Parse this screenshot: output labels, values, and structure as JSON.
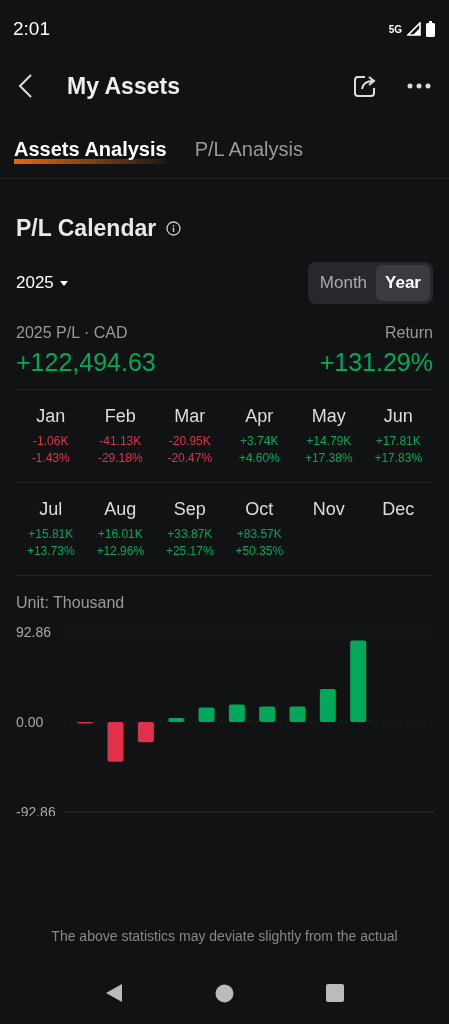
{
  "status_bar": {
    "time": "2:01",
    "network": "5G"
  },
  "header": {
    "title": "My Assets"
  },
  "tabs": [
    {
      "label": "Assets Analysis",
      "selected": true
    },
    {
      "label": "P/L Analysis",
      "selected": false
    }
  ],
  "section": {
    "title": "P/L Calendar"
  },
  "year_picker": {
    "value": "2025"
  },
  "period_toggle": [
    {
      "label": "Month",
      "selected": false
    },
    {
      "label": "Year",
      "selected": true
    }
  ],
  "summary": {
    "label": "2025 P/L · CAD",
    "value": "+122,494.63",
    "return_label": "Return",
    "return_value": "+131.29%",
    "color": "#00a85a"
  },
  "months": [
    {
      "name": "Jan",
      "pl": "-1.06K",
      "pct": "-1.43%",
      "color": "#e0314b"
    },
    {
      "name": "Feb",
      "pl": "-41.13K",
      "pct": "-29.18%",
      "color": "#e0314b"
    },
    {
      "name": "Mar",
      "pl": "-20.95K",
      "pct": "-20.47%",
      "color": "#e0314b"
    },
    {
      "name": "Apr",
      "pl": "+3.74K",
      "pct": "+4.60%",
      "color": "#00a85a"
    },
    {
      "name": "May",
      "pl": "+14.79K",
      "pct": "+17.38%",
      "color": "#00a85a"
    },
    {
      "name": "Jun",
      "pl": "+17.81K",
      "pct": "+17.83%",
      "color": "#00a85a"
    },
    {
      "name": "Jul",
      "pl": "+15.81K",
      "pct": "+13.73%",
      "color": "#00a85a"
    },
    {
      "name": "Aug",
      "pl": "+16.01K",
      "pct": "+12.96%",
      "color": "#00a85a"
    },
    {
      "name": "Sep",
      "pl": "+33.87K",
      "pct": "+25.17%",
      "color": "#00a85a"
    },
    {
      "name": "Oct",
      "pl": "+83.57K",
      "pct": "+50.35%",
      "color": "#00a85a"
    },
    {
      "name": "Nov"
    },
    {
      "name": "Dec"
    }
  ],
  "unit": "Unit: Thousand",
  "chart": {
    "chart_data": {
      "type": "bar",
      "values": [
        -1,
        -41,
        -21,
        4,
        15,
        18,
        16,
        16,
        34,
        84,
        null,
        null
      ],
      "ylim": [
        -92.86,
        92.86
      ],
      "yticks": [
        {
          "value": 92.86,
          "label": "92.86"
        },
        {
          "value": 0,
          "label": "0.00"
        },
        {
          "value": -92.86,
          "label": "-92.86"
        }
      ]
    }
  },
  "footnote": "The above statistics may deviate slightly from the actual"
}
